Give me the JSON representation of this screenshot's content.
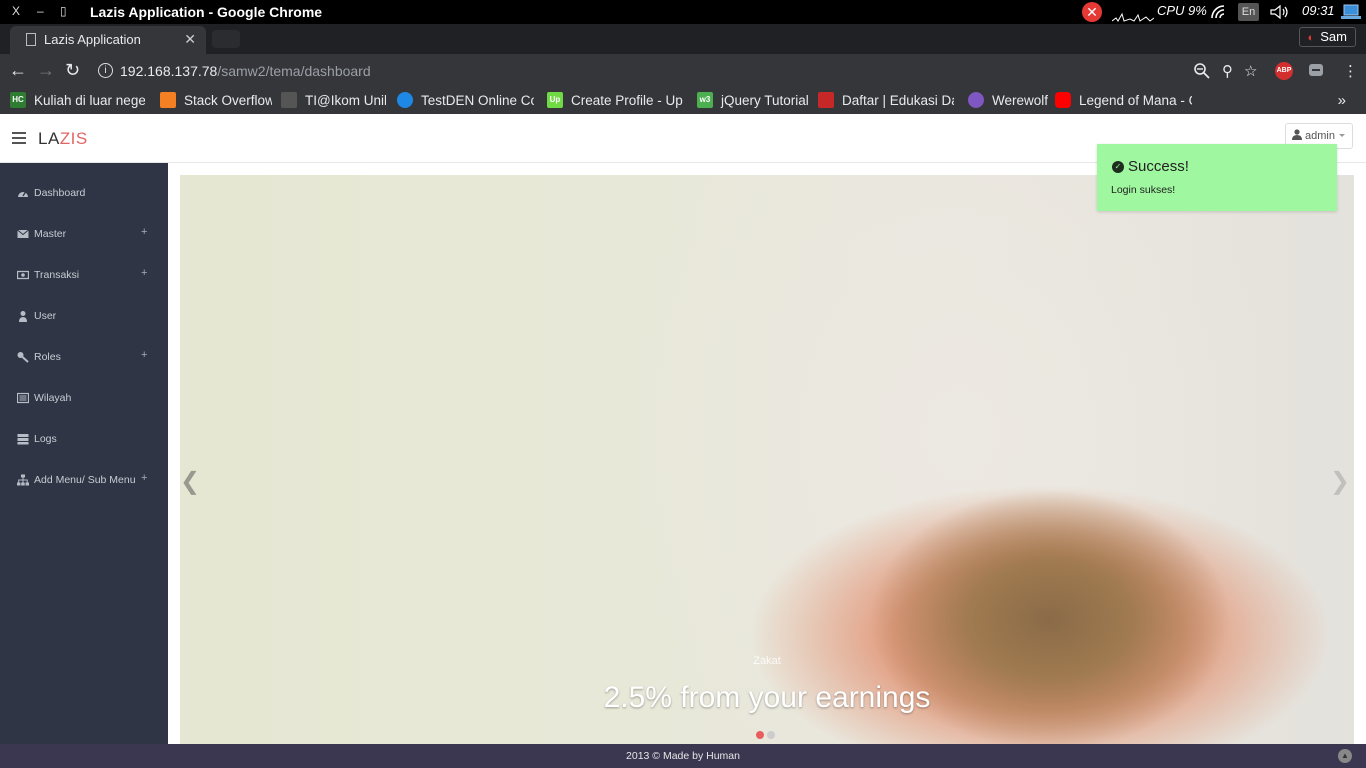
{
  "os": {
    "window_title": "Lazis Application - Google Chrome",
    "cpu": "CPU 9%",
    "lang": "En",
    "time": "09:31"
  },
  "browser": {
    "tab_title": "Lazis Application",
    "profile_name": "Sam",
    "url_host": "192.168.137.78",
    "url_path": "/samw2/tema/dashboard",
    "abp_label": "ABP",
    "bookmarks": [
      {
        "label": "Kuliah di luar negeri",
        "icon": "hc-icon",
        "icon_text": "HC",
        "color": "#2e7d32"
      },
      {
        "label": "Stack Overflow",
        "icon": "stackoverflow-icon",
        "icon_text": "",
        "color": "#f48024"
      },
      {
        "label": "TI@Ikom Unika",
        "icon": "unika-icon",
        "icon_text": "",
        "color": "#555555"
      },
      {
        "label": "TestDEN Online Co",
        "icon": "testden-icon",
        "icon_text": "",
        "color": "#1e88e5"
      },
      {
        "label": "Create Profile - Up",
        "icon": "upwork-icon",
        "icon_text": "Up",
        "color": "#6fda44"
      },
      {
        "label": "jQuery Tutorial",
        "icon": "w3-icon",
        "icon_text": "w3",
        "color": "#4caf50"
      },
      {
        "label": "Daftar | Edukasi Dar",
        "icon": "edukasi-icon",
        "icon_text": "",
        "color": "#c62828"
      },
      {
        "label": "Werewolf",
        "icon": "werewolf-icon",
        "icon_text": "",
        "color": "#7e57c2"
      },
      {
        "label": "Legend of Mana - O",
        "icon": "youtube-icon",
        "icon_text": "",
        "color": "#ff0000"
      }
    ]
  },
  "app": {
    "brand_a": "LA",
    "brand_b": "ZIS",
    "user": "admin",
    "menu": [
      {
        "label": "Dashboard",
        "name": "dashboard",
        "has_plus": false
      },
      {
        "label": "Master",
        "name": "master",
        "has_plus": true
      },
      {
        "label": "Transaksi",
        "name": "transaksi",
        "has_plus": true
      },
      {
        "label": "User",
        "name": "user",
        "has_plus": false
      },
      {
        "label": "Roles",
        "name": "roles",
        "has_plus": true
      },
      {
        "label": "Wilayah",
        "name": "wilayah",
        "has_plus": false
      },
      {
        "label": "Logs",
        "name": "logs",
        "has_plus": false
      },
      {
        "label": "Add Menu/ Sub Menu",
        "name": "add-menu",
        "has_plus": true
      }
    ],
    "plus_symbol": "+",
    "carousel": {
      "caption_small": "Zakat",
      "caption_big": "2.5% from your earnings"
    },
    "toast": {
      "title": "Success!",
      "message": "Login sukses!",
      "color": "#9ff79f"
    },
    "footer": "2013 © Made by Human"
  }
}
